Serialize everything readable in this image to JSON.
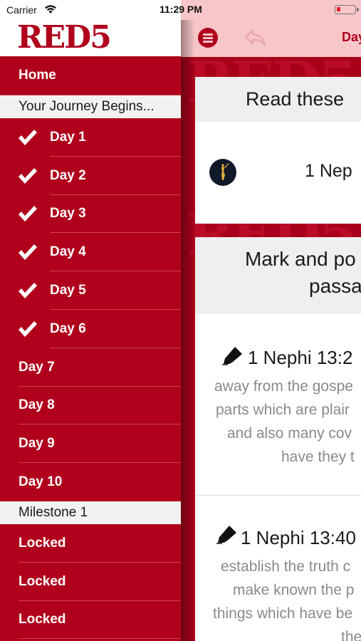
{
  "status_bar": {
    "carrier": "Carrier",
    "time": "11:29 PM"
  },
  "sidebar": {
    "logo": "RED5",
    "home": "Home",
    "section1_header": "Your Journey Begins...",
    "days": [
      {
        "label": "Day 1",
        "checked": true
      },
      {
        "label": "Day 2",
        "checked": true
      },
      {
        "label": "Day 3",
        "checked": true
      },
      {
        "label": "Day 4",
        "checked": true
      },
      {
        "label": "Day 5",
        "checked": true
      },
      {
        "label": "Day 6",
        "checked": true
      },
      {
        "label": "Day 7",
        "checked": false
      },
      {
        "label": "Day 8",
        "checked": false
      },
      {
        "label": "Day 9",
        "checked": false
      },
      {
        "label": "Day 10",
        "checked": false
      }
    ],
    "section2_header": "Milestone 1",
    "locked_items": [
      {
        "label": "Locked"
      },
      {
        "label": "Locked"
      },
      {
        "label": "Locked"
      }
    ]
  },
  "main": {
    "topbar_title": "Day",
    "watermark": "RED5",
    "read_card": {
      "heading": "Read these",
      "reference": "1 Nep"
    },
    "mark_card": {
      "heading_line1": "Mark and po",
      "heading_line2": "passa",
      "verses": [
        {
          "reference": "1 Nephi 13:2",
          "lines": [
            "away from the gospe",
            "parts which are plair",
            "and also many cov",
            "have they t"
          ]
        },
        {
          "reference": "1 Nephi 13:40",
          "lines": [
            "establish the truth c",
            "make known the p",
            "things which have be",
            "the"
          ]
        }
      ]
    }
  },
  "colors": {
    "brand_red": "#b0001c",
    "topbar_pink": "#f7c6c8",
    "section_header_bg": "#f2f2f2"
  }
}
